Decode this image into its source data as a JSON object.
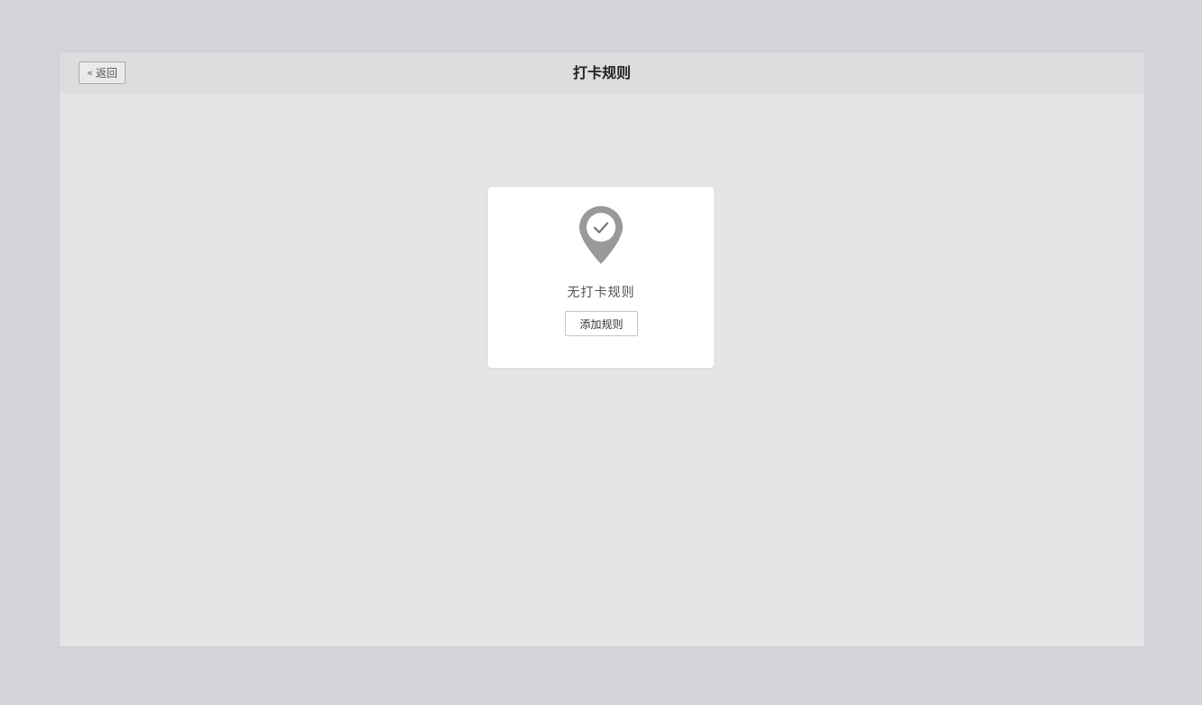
{
  "header": {
    "back_label": "返回",
    "title": "打卡规则"
  },
  "empty_state": {
    "icon": "location-check-icon",
    "message": "无打卡规则",
    "add_button_label": "添加规则"
  },
  "colors": {
    "background": "#d2d4d8",
    "window": "#e4e5e7",
    "header": "#dcdddf",
    "card": "#ffffff",
    "icon": "#999999"
  }
}
